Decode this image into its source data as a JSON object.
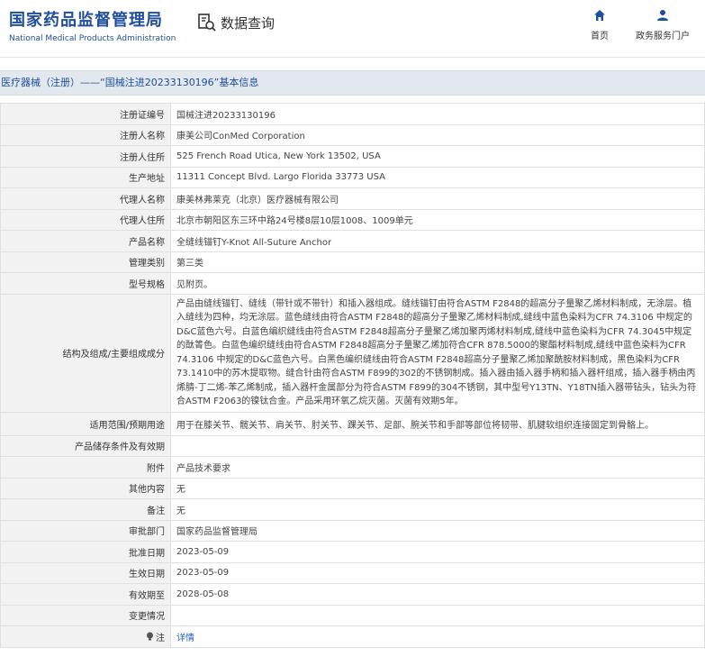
{
  "header": {
    "logo_cn": "国家药品监督管理局",
    "logo_en": "National Medical Products Administration",
    "search_label": "数据查询",
    "nav_home": "首页",
    "nav_gov": "政务服务门户"
  },
  "title": "医疗器械（注册）——“国械注进20233130196”基本信息",
  "rows": [
    {
      "key": "注册证编号",
      "value": "国械注进20233130196"
    },
    {
      "key": "注册人名称",
      "value": "康美公司ConMed Corporation"
    },
    {
      "key": "注册人住所",
      "value": "525 French Road Utica, New York 13502, USA"
    },
    {
      "key": "生产地址",
      "value": "11311 Concept Blvd. Largo Florida 33773 USA"
    },
    {
      "key": "代理人名称",
      "value": "康美林弗莱克（北京）医疗器械有限公司"
    },
    {
      "key": "代理人住所",
      "value": "北京市朝阳区东三环中路24号楼8层10层1008、1009单元"
    },
    {
      "key": "产品名称",
      "value": "全缝线锚钉Y-Knot All-Suture Anchor"
    },
    {
      "key": "管理类别",
      "value": "第三类"
    },
    {
      "key": "型号规格",
      "value": "见附页。"
    },
    {
      "key": "结构及组成/主要组成成分",
      "value": "产品由缝线锚钉、缝线（带针或不带针）和插入器组成。缝线锚钉由符合ASTM F2848的超高分子量聚乙烯材料制成，无涂层。植入缝线为四种，均无涂层。蓝色缝线由符合ASTM F2848的超高分子量聚乙烯材料制成,缝线中蓝色染料为CFR 74.3106 中规定的D&C蓝色六号。白蓝色编织缝线由符合ASTM F2848超高分子量聚乙烯加聚丙烯材料制成,缝线中蓝色染料为CFR 74.3045中规定的酞箐色。白蓝色编织缝线由符合ASTM F2848超高分子量聚乙烯加符合CFR 878.5000的聚酯材料制成,缝线中蓝色染料为CFR 74.3106 中规定的D&C蓝色六号。白黑色编织缝线由符合ASTM F2848超高分子量聚乙烯加聚酰胺材料制成，黑色染料为CFR 73.1410中的苏木提取物。缝合针由符合ASTM F899的302的不锈钢制成。插入器由插入器手柄和插入器杆组成，插入器手柄由丙烯腈-丁二烯-苯乙烯制成，插入器杆金属部分为符合ASTM F899的304不锈钢，其中型号Y13TN、Y18TN插入器带钻头，钻头为符合ASTM F2063的镍钛合金。产品采用环氧乙烷灭菌。灭菌有效期5年。"
    },
    {
      "key": "适用范围/预期用途",
      "value": "用于在膝关节、髋关节、肩关节、肘关节、踝关节、足部、腕关节和手部等部位将韧带、肌腱软组织连接固定到骨骼上。"
    },
    {
      "key": "产品储存条件及有效期",
      "value": ""
    },
    {
      "key": "附件",
      "value": "产品技术要求"
    },
    {
      "key": "其他内容",
      "value": "无"
    },
    {
      "key": "备注",
      "value": "无"
    },
    {
      "key": "审批部门",
      "value": "国家药品监督管理局"
    },
    {
      "key": "批准日期",
      "value": "2023-05-09"
    },
    {
      "key": "生效日期",
      "value": "2023-05-09"
    },
    {
      "key": "有效期至",
      "value": "2028-05-08"
    },
    {
      "key": "变更情况",
      "value": ""
    }
  ],
  "note_row": {
    "key": "注",
    "value": "详情"
  },
  "colors": {
    "brand_blue": "#1f4e9a",
    "link_blue": "#1e5fc2",
    "title_bg": "#e3e8ef"
  },
  "icons": {
    "search": "document-search-icon",
    "home": "home-icon",
    "user": "user-icon",
    "note": "bulb-icon"
  }
}
